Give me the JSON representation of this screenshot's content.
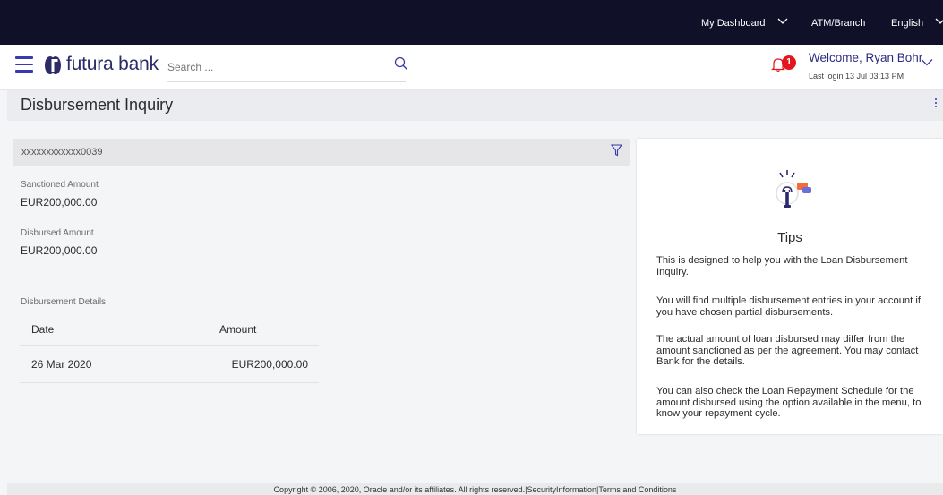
{
  "topbar": {
    "dashboard_label": "My Dashboard",
    "atm_label": "ATM/Branch",
    "language_label": "English"
  },
  "header": {
    "logo_text": "futura bank",
    "search_placeholder": "Search ...",
    "notification_count": "1",
    "welcome_text": "Welcome, Ryan Bohr",
    "last_login": "Last login 13 Jul 03:13 PM"
  },
  "page": {
    "title": "Disbursement Inquiry"
  },
  "account": {
    "number": "xxxxxxxxxxxx0039",
    "sanctioned_label": "Sanctioned Amount",
    "sanctioned_value": "EUR200,000.00",
    "disbursed_label": "Disbursed Amount",
    "disbursed_value": "EUR200,000.00"
  },
  "details": {
    "section_label": "Disbursement Details",
    "columns": [
      "Date",
      "Amount"
    ],
    "rows": [
      {
        "date": "26 Mar 2020",
        "amount": "EUR200,000.00"
      }
    ]
  },
  "tips": {
    "title": "Tips",
    "items": [
      "This is designed to help you with the Loan Disbursement Inquiry.",
      "You will find multiple disbursement entries in your account if you have chosen partial disbursements.",
      "The actual amount of loan disbursed may differ from the amount sanctioned as per the agreement. You may contact Bank for the details.",
      "You can also check the Loan Repayment Schedule for the amount disbursed using the option available in the menu, to know your repayment cycle."
    ]
  },
  "footer": {
    "text": "Copyright © 2006, 2020, Oracle and/or its affiliates. All rights reserved.|SecurityInformation|Terms and Conditions"
  },
  "colors": {
    "topbar_bg": "#101029",
    "brand_blue": "#2b2b80",
    "accent_blue": "#3a3ab0",
    "badge_red": "#e2161c",
    "tips_orange": "#f26b3a"
  },
  "icons": [
    "hamburger-icon",
    "futura-logo-icon",
    "search-icon",
    "bell-icon",
    "chevron-down-icon",
    "kebab-menu-icon",
    "filter-icon",
    "lightbulb-tips-icon"
  ]
}
